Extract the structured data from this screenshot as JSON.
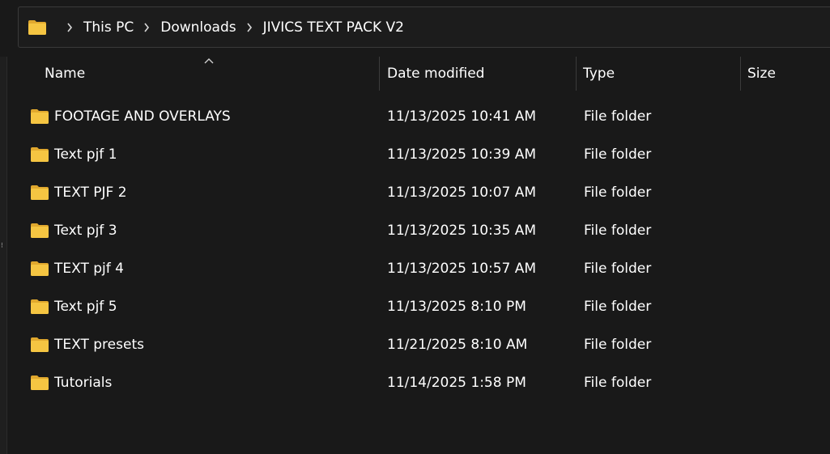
{
  "address_bar": {
    "crumbs": [
      "This PC",
      "Downloads",
      "JIVICS TEXT PACK V2"
    ]
  },
  "columns": {
    "name": "Name",
    "date": "Date modified",
    "type": "Type",
    "size": "Size"
  },
  "rows": [
    {
      "name": "FOOTAGE AND OVERLAYS",
      "date": "11/13/2025 10:41 AM",
      "type": "File folder",
      "size": ""
    },
    {
      "name": "Text pjf 1",
      "date": "11/13/2025 10:39 AM",
      "type": "File folder",
      "size": ""
    },
    {
      "name": "TEXT PJF 2",
      "date": "11/13/2025 10:07 AM",
      "type": "File folder",
      "size": ""
    },
    {
      "name": "Text pjf 3",
      "date": "11/13/2025 10:35 AM",
      "type": "File folder",
      "size": ""
    },
    {
      "name": "TEXT pjf 4",
      "date": "11/13/2025 10:57 AM",
      "type": "File folder",
      "size": ""
    },
    {
      "name": "Text pjf 5",
      "date": "11/13/2025 8:10 PM",
      "type": "File folder",
      "size": ""
    },
    {
      "name": "TEXT presets",
      "date": "11/21/2025 8:10 AM",
      "type": "File folder",
      "size": ""
    },
    {
      "name": "Tutorials",
      "date": "11/14/2025 1:58 PM",
      "type": "File folder",
      "size": ""
    }
  ],
  "icons": {
    "address_root": "folder-icon",
    "row_icon": "folder-icon",
    "separator": "chevron-right-icon",
    "sort_indicator": "chevron-up-icon"
  },
  "colors": {
    "folder_body": "#f5c542",
    "folder_tab": "#e0a82e",
    "background": "#191919"
  }
}
